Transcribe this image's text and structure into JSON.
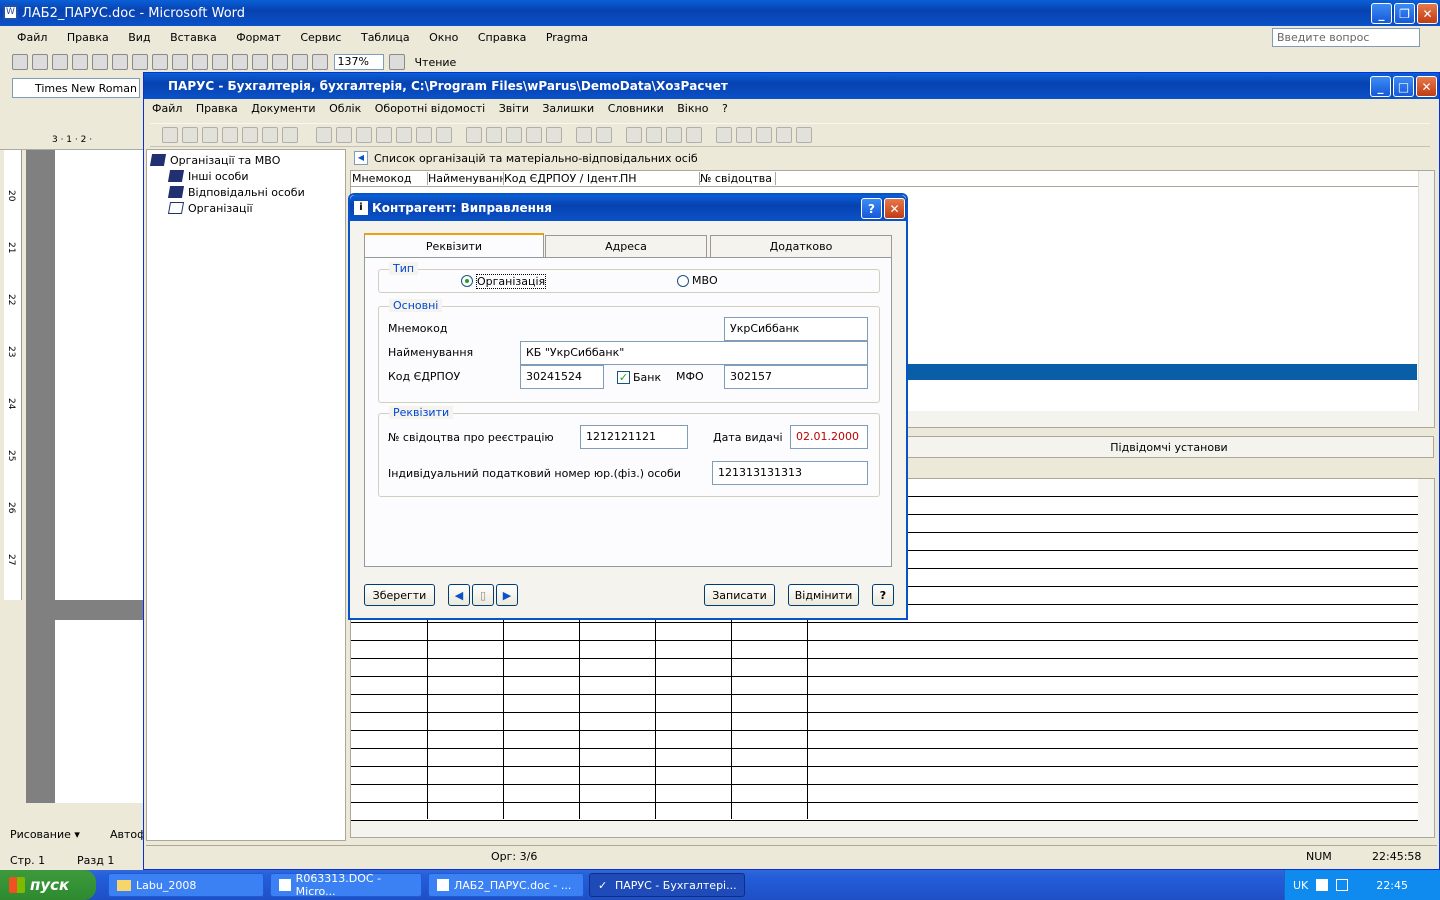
{
  "word": {
    "title": "ЛАБ2_ПАРУС.doc - Microsoft Word",
    "menu": [
      "Файл",
      "Правка",
      "Вид",
      "Вставка",
      "Формат",
      "Сервис",
      "Таблица",
      "Окно",
      "Справка",
      "Pragma"
    ],
    "ask": "Введите вопрос",
    "zoom": "137%",
    "reading": "Чтение",
    "font": "Times New Roman",
    "drawing": "Рисование ▾",
    "autoshapes": "Автоф",
    "status_page": "Стр. 1",
    "status_section": "Разд 1",
    "ruler_top": "3 · 1 · 2 ·",
    "ruler_nums": [
      "20",
      "21",
      "22",
      "23",
      "24",
      "25",
      "26",
      "27"
    ]
  },
  "parus": {
    "title": "ПАРУС - Бухгалтерія, бухгалтерія, C:\\Program Files\\wParus\\DemoData\\ХозРасчет",
    "menu": [
      "Файл",
      "Правка",
      "Документи",
      "Облік",
      "Оборотні відомості",
      "Звіти",
      "Залишки",
      "Словники",
      "Вікно",
      "?"
    ],
    "tree": {
      "root": "Організації та МВО",
      "children": [
        "Інші особи",
        "Відповідальні особи",
        "Організації"
      ]
    },
    "list_title": "Список організацій та матеріально-відповідальних осіб",
    "columns": [
      "Мнемокод",
      "Найменування",
      "Код ЄДРПОУ / Ідент. і",
      "ПН",
      "№ свідоцтва пр"
    ],
    "subordinate": "Підвідомчі установи",
    "status": {
      "record": "Орг: 3/6",
      "num": "NUM",
      "time": "22:45:58"
    }
  },
  "dialog": {
    "title": "Контрагент: Виправлення",
    "tabs": [
      "Реквізити",
      "Адреса",
      "Додатково"
    ],
    "type_group": "Тип",
    "radio_org": "Організація",
    "radio_mvo": "МВО",
    "main_group": "Основні",
    "mnemocode_label": "Мнемокод",
    "mnemocode": "УкрСиббанк",
    "name_label": "Найменування",
    "name": "КБ \"УкрСиббанк\"",
    "edrpou_label": "Код ЄДРПОУ",
    "edrpou": "30241524",
    "bank_label": "Банк",
    "mfo_label": "МФО",
    "mfo": "302157",
    "req_group": "Реквізити",
    "cert_label": "№ свідоцтва про реєстрацію",
    "cert": "1212121121",
    "date_label": "Дата видачі",
    "date": "02.01.2000",
    "inn_label": "Індивідуальний податковий номер юр.(фіз.) особи",
    "inn": "121313131313",
    "save": "Зберегти",
    "write": "Записати",
    "cancel": "Відмінити",
    "help": "?"
  },
  "taskbar": {
    "start": "пуск",
    "items": [
      "Labu_2008",
      "R063313.DOC - Micro...",
      "ЛАБ2_ПАРУС.doc - ...",
      "ПАРУС - Бухгалтері..."
    ],
    "lang": "UK",
    "clock": "22:45"
  },
  "colors": {
    "accent": "#0a52c8",
    "selected_row": "#0a5ea8",
    "date_red": "#c00000"
  }
}
